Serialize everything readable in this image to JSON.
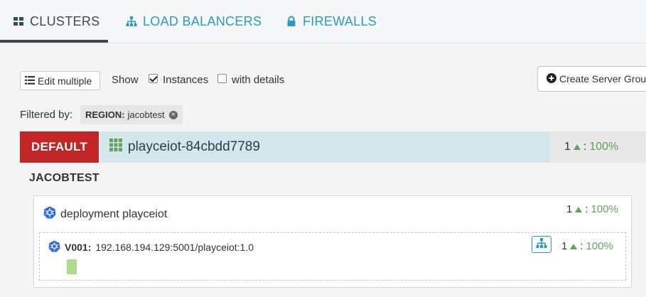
{
  "tabs": [
    {
      "label": "CLUSTERS",
      "icon": "grid-icon"
    },
    {
      "label": "LOAD BALANCERS",
      "icon": "sitemap-icon"
    },
    {
      "label": "FIREWALLS",
      "icon": "lock-icon"
    }
  ],
  "toolbar": {
    "edit_multiple": "Edit multiple",
    "show_label": "Show",
    "instances_label": "Instances",
    "instances_checked": true,
    "details_label": "with details",
    "details_checked": false,
    "create_label": "Create Server Group"
  },
  "filter": {
    "label": "Filtered by:",
    "key": "REGION:",
    "value": "jacobtest"
  },
  "cluster": {
    "environment": "DEFAULT",
    "name": "playceiot-84cbdd7789",
    "count": "1",
    "percent": "100%"
  },
  "region": {
    "name": "JACOBTEST",
    "deployment": {
      "name": "deployment playceiot",
      "count": "1",
      "percent": "100%",
      "server_group": {
        "version": "V001:",
        "detail": "192.168.194.129:5001/playceiot:1.0",
        "count": "1",
        "percent": "100%"
      }
    }
  },
  "colors": {
    "accent": "#2a9ac3",
    "environment_badge": "#c12525",
    "healthy": "#63a25d",
    "instance_up": "#b3d98e"
  }
}
